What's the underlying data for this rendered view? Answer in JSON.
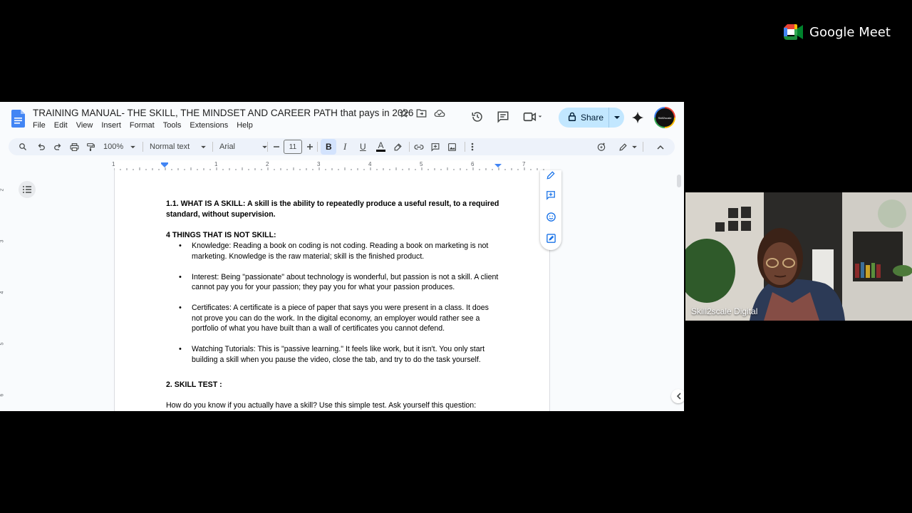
{
  "meet": {
    "brand": "Google Meet",
    "participant": "Skill2scale Digital"
  },
  "doc": {
    "title": "TRAINING MANUAL- THE SKILL, THE MINDSET AND CAREER PATH that pays in 2026",
    "menus": [
      "File",
      "Edit",
      "View",
      "Insert",
      "Format",
      "Tools",
      "Extensions",
      "Help"
    ],
    "share_label": "Share",
    "avatar_text": "Skill2scale"
  },
  "toolbar": {
    "zoom": "100%",
    "style": "Normal text",
    "font": "Arial",
    "font_size": "11"
  },
  "ruler": {
    "numbers": [
      "1",
      "1",
      "2",
      "3",
      "4",
      "5",
      "6",
      "7"
    ],
    "vertical": [
      "2",
      "3",
      "4",
      "5",
      "6"
    ]
  },
  "content": {
    "heading": "1.1. WHAT IS A SKILL: A skill is the ability to repeatedly produce a useful result, to a required standard, without supervision.",
    "list_title": "4 THINGS THAT IS NOT SKILL:",
    "bullets": [
      "Knowledge: Reading a book on coding is not coding. Reading a book on marketing is not marketing. Knowledge is the raw material; skill is the finished product.",
      "Interest: Being \"passionate\" about technology is wonderful, but passion is not a skill. A client cannot pay you for your passion; they pay you for what your passion produces.",
      "Certificates: A certificate is a piece of paper that says you were present in a class. It does not prove you can do the work. In the digital economy, an employer would rather see a portfolio of what you have built than a wall of certificates you cannot defend.",
      "Watching Tutorials: This is \"passive learning.\" It feels like work, but it isn't. You only start building a skill when you pause the video, close the tab, and try to do the task yourself."
    ],
    "section2": "2. SKILL TEST :",
    "section2_text": "How do you know if you actually have a skill? Use this simple test. Ask yourself this question:"
  },
  "colors": {
    "share_bg": "#c2e7ff",
    "docs_blue": "#4285f4",
    "toolbar_bg": "#edf2fa"
  }
}
